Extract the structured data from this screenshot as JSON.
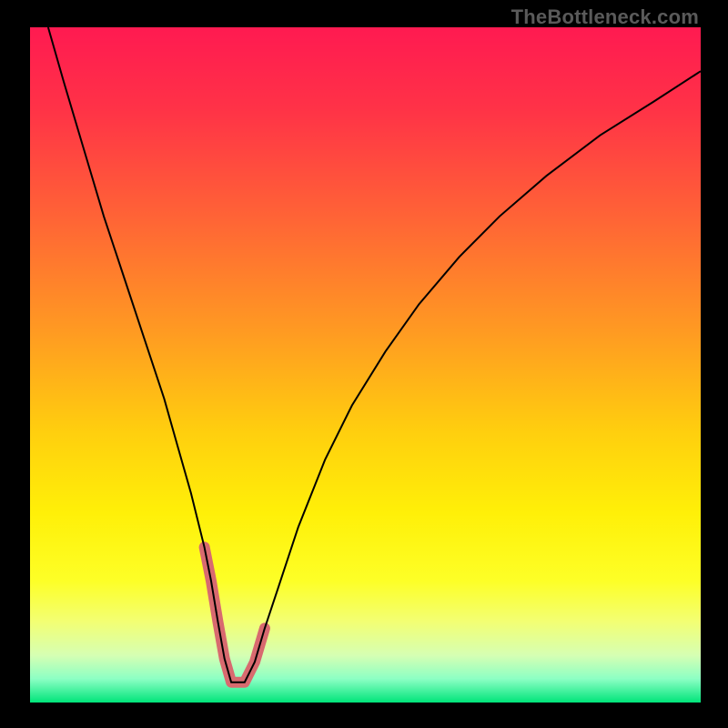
{
  "watermark": "TheBottleneck.com",
  "chart_data": {
    "type": "line",
    "title": "",
    "xlabel": "",
    "ylabel": "",
    "xlim": [
      0,
      100
    ],
    "ylim": [
      0,
      100
    ],
    "grid": false,
    "legend": false,
    "background_gradient": {
      "stops": [
        {
          "offset": 0.0,
          "color": "#ff1a51"
        },
        {
          "offset": 0.12,
          "color": "#ff3247"
        },
        {
          "offset": 0.28,
          "color": "#ff6336"
        },
        {
          "offset": 0.45,
          "color": "#ff9a22"
        },
        {
          "offset": 0.6,
          "color": "#ffcf0e"
        },
        {
          "offset": 0.72,
          "color": "#fff008"
        },
        {
          "offset": 0.82,
          "color": "#fdff27"
        },
        {
          "offset": 0.88,
          "color": "#f3ff73"
        },
        {
          "offset": 0.93,
          "color": "#d6ffb3"
        },
        {
          "offset": 0.965,
          "color": "#8cffc4"
        },
        {
          "offset": 1.0,
          "color": "#00e57a"
        }
      ]
    },
    "series": [
      {
        "name": "bottleneck-curve",
        "stroke": "#000000",
        "stroke_width": 2,
        "x": [
          2.7,
          5,
          8,
          11,
          14,
          17,
          20,
          22,
          24,
          26,
          27,
          28,
          29,
          30,
          32,
          33.5,
          35,
          37,
          40,
          44,
          48,
          53,
          58,
          64,
          70,
          77,
          85,
          93,
          100
        ],
        "values": [
          100,
          92,
          82,
          72,
          63,
          54,
          45,
          38,
          31,
          23,
          18,
          12,
          6.5,
          3,
          3,
          6,
          11,
          17,
          26,
          36,
          44,
          52,
          59,
          66,
          72,
          78,
          84,
          89,
          93.5
        ]
      },
      {
        "name": "highlight-floor",
        "stroke": "#d86a6f",
        "stroke_width": 12,
        "linecap": "round",
        "x": [
          26,
          27,
          28,
          29,
          30,
          32,
          33.5,
          35
        ],
        "values": [
          23,
          18,
          12,
          6.5,
          3,
          3,
          6,
          11
        ]
      }
    ],
    "annotations": []
  }
}
